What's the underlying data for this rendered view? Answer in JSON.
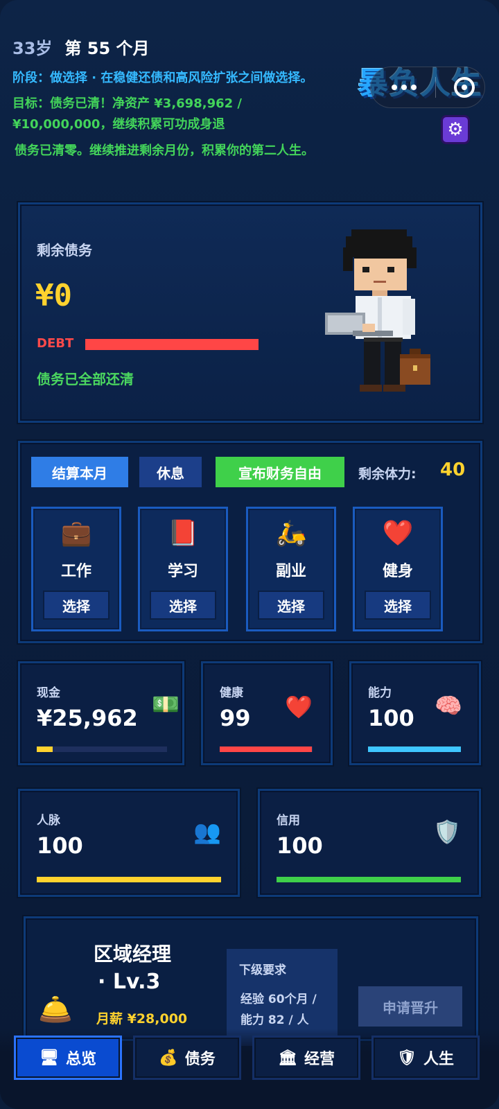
{
  "header": {
    "age": "33岁",
    "month": "第 55 个月",
    "stage": "阶段：做选择 · 在稳健还债和高风险扩张之间做选择。",
    "goal": "目标：债务已清！净资产 ¥3,698,962 / ¥10,000,000，继续积累可功成身退",
    "note": "债务已清零。继续推进剩余月份，积累你的第二人生。"
  },
  "logo": {
    "text": "暴负人生"
  },
  "debt": {
    "title": "剩余债务",
    "value": "¥0",
    "bar_label": "DEBT",
    "status": "债务已全部还清"
  },
  "actions": {
    "settle": "结算本月",
    "rest": "休息",
    "freedom": "宣布财务自由",
    "stamina_label": "剩余体力:",
    "stamina_value": "40",
    "cards": [
      {
        "name": "工作",
        "icon": "briefcase-icon",
        "button": "选择"
      },
      {
        "name": "学习",
        "icon": "book-icon",
        "button": "选择"
      },
      {
        "name": "副业",
        "icon": "scooter-icon",
        "button": "选择"
      },
      {
        "name": "健身",
        "icon": "heart-icon",
        "button": "选择"
      }
    ]
  },
  "stats": {
    "cash": {
      "label": "现金",
      "value": "¥25,962",
      "icon": "money-icon",
      "color": "#ffd22e",
      "level": 0.12
    },
    "health": {
      "label": "健康",
      "value": "99",
      "icon": "heart-icon",
      "color": "#ff4646",
      "level": 0.99
    },
    "ability": {
      "label": "能力",
      "value": "100",
      "icon": "brain-icon",
      "color": "#3fc6ff",
      "level": 1.0
    },
    "network": {
      "label": "人脉",
      "value": "100",
      "icon": "people-icon",
      "color": "#ffd22e",
      "level": 1.0
    },
    "credit": {
      "label": "信用",
      "value": "100",
      "icon": "shield-star-icon",
      "color": "#3fd04a",
      "level": 1.0
    }
  },
  "career": {
    "title": "区域经理",
    "level": "· Lv.3",
    "salary": "月薪 ¥28,000",
    "req_title": "下级要求",
    "req_text": "经验 60个月 / 能力 82 / 人",
    "promote": "申请晋升"
  },
  "nav": [
    {
      "label": "总览",
      "icon": "monitor-icon",
      "active": true
    },
    {
      "label": "债务",
      "icon": "moneybag-icon",
      "active": false
    },
    {
      "label": "经营",
      "icon": "building-icon",
      "active": false
    },
    {
      "label": "人生",
      "icon": "shield-star-icon",
      "active": false
    }
  ],
  "colors": {
    "background": "#0b1d3a",
    "accent_blue": "#2f7de6",
    "accent_green": "#3fd04a",
    "accent_yellow": "#ffd22e",
    "accent_red": "#ff4646"
  }
}
